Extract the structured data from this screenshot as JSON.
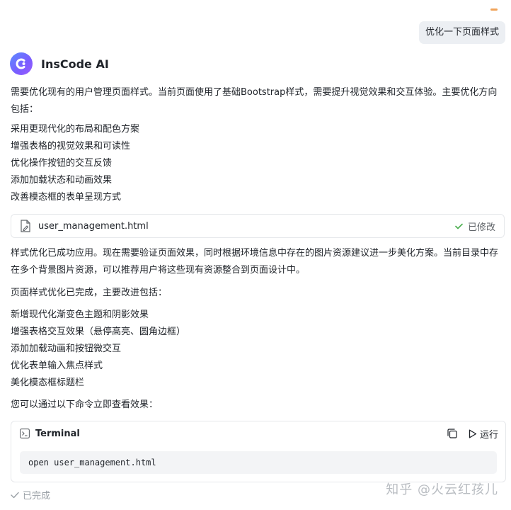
{
  "user_message": "优化一下页面样式",
  "assistant": {
    "name": "InsCode AI",
    "intro_paragraph": "需要优化现有的用户管理页面样式。当前页面使用了基础Bootstrap样式，需要提升视觉效果和交互体验。主要优化方向包括：",
    "plan_items": [
      "采用更现代化的布局和配色方案",
      "增强表格的视觉效果和可读性",
      "优化操作按钮的交互反馈",
      "添加加载状态和动画效果",
      "改善模态框的表单呈现方式"
    ],
    "file_card": {
      "filename": "user_management.html",
      "status": "已修改"
    },
    "applied_paragraph": "样式优化已成功应用。现在需要验证页面效果，同时根据环境信息中存在的图片资源建议进一步美化方案。当前目录中存在多个背景图片资源，可以推荐用户将这些现有资源整合到页面设计中。",
    "summary_heading": "页面样式优化已完成，主要改进包括：",
    "improvements": [
      "新增现代化渐变色主题和阴影效果",
      "增强表格交互效果（悬停高亮、圆角边框）",
      "添加加载动画和按钮微交互",
      "优化表单输入焦点样式",
      "美化模态框标题栏"
    ],
    "command_intro": "您可以通过以下命令立即查看效果：",
    "terminal": {
      "title": "Terminal",
      "run_label": "运行",
      "command": "open user_management.html"
    },
    "done_label": "已完成"
  },
  "watermark": "知乎 @火云红孩儿",
  "colors": {
    "accent_gradient_start": "#5b8cff",
    "accent_gradient_end": "#9b5cff",
    "success_check": "#4caf50",
    "muted_text": "#9aa0a6"
  }
}
